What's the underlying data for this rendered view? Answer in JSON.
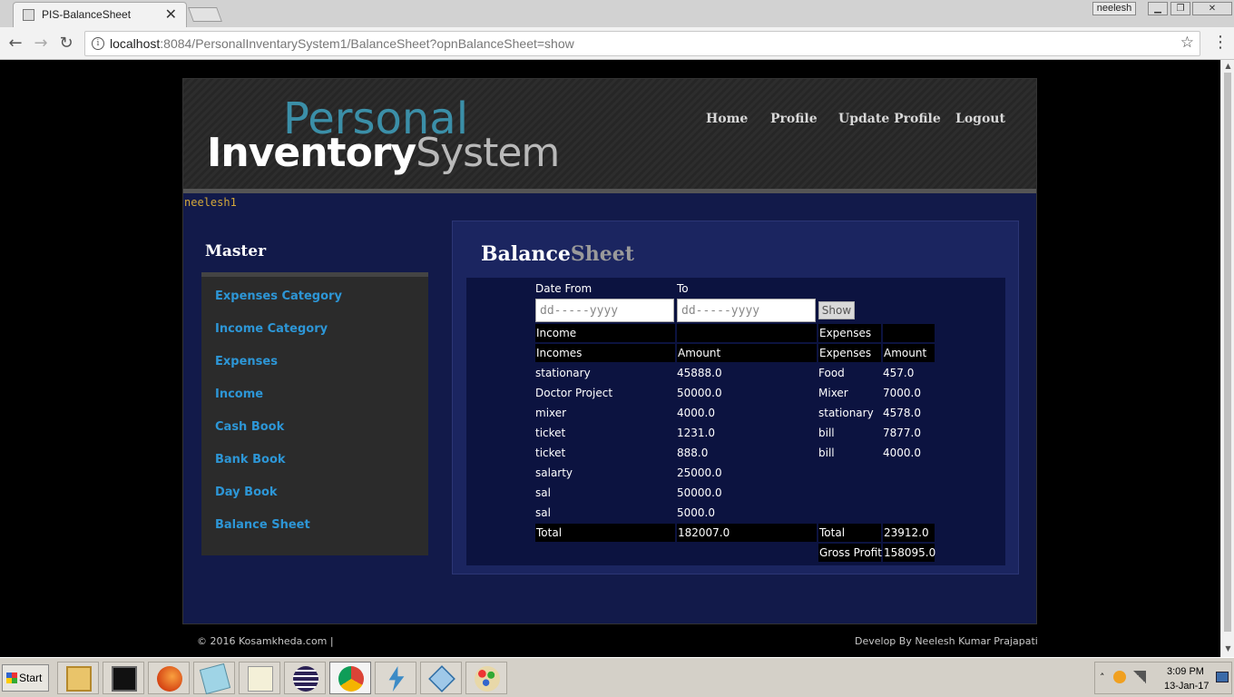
{
  "browser": {
    "tab_title": "PIS-BalanceSheet",
    "tab_close": "✕",
    "profile_chip": "neelesh",
    "url_host": "localhost",
    "url_rest": ":8084/PersonalInventarySystem1/BalanceSheet?opnBalanceSheet=show"
  },
  "site": {
    "logo_top": "Personal",
    "logo_bottom_a": "Inventory",
    "logo_bottom_b": "System",
    "nav": [
      "Home",
      "Profile",
      "Update Profile",
      "Logout"
    ],
    "username": "neelesh1",
    "sidebar_title": "Master",
    "sidebar_items": [
      "Expenses Category",
      "Income Category",
      "Expenses",
      "Income",
      "Cash Book",
      "Bank Book",
      "Day Book",
      "Balance Sheet"
    ],
    "page_title_a": "Balance",
    "page_title_b": "Sheet",
    "footer_left": "© 2016 Kosamkheda.com |",
    "footer_right": "Develop By Neelesh Kumar Prajapati"
  },
  "form": {
    "date_from_label": "Date From",
    "to_label": "To",
    "date_placeholder": "dd-----yyyy",
    "show_button": "Show"
  },
  "report": {
    "income_header": "Income",
    "expenses_header": "Expenses",
    "incomes_col": "Incomes",
    "amount_col": "Amount",
    "expenses_col": "Expenses",
    "income_rows": [
      {
        "name": "stationary",
        "amount": "45888.0"
      },
      {
        "name": "Doctor Project",
        "amount": "50000.0"
      },
      {
        "name": "mixer",
        "amount": "4000.0"
      },
      {
        "name": "ticket",
        "amount": "1231.0"
      },
      {
        "name": "ticket",
        "amount": "888.0"
      },
      {
        "name": "salarty",
        "amount": "25000.0"
      },
      {
        "name": "sal",
        "amount": "50000.0"
      },
      {
        "name": "sal",
        "amount": "5000.0"
      }
    ],
    "expense_rows": [
      {
        "name": "Food",
        "amount": "457.0"
      },
      {
        "name": "Mixer",
        "amount": "7000.0"
      },
      {
        "name": "stationary",
        "amount": "4578.0"
      },
      {
        "name": "bill",
        "amount": "7877.0"
      },
      {
        "name": "bill",
        "amount": "4000.0"
      }
    ],
    "total_label": "Total",
    "income_total": "182007.0",
    "expense_total": "23912.0",
    "gross_profit_label": "Gross Profit",
    "gross_profit": "158095.0"
  },
  "taskbar": {
    "start_label": "Start",
    "apps": [
      "file-explorer",
      "command-prompt",
      "firefox",
      "notepad-like",
      "text-editor",
      "eclipse",
      "chrome",
      "flash-app",
      "virtualbox",
      "paint"
    ],
    "clock_time": "3:09 PM",
    "clock_date": "13-Jan-17"
  }
}
